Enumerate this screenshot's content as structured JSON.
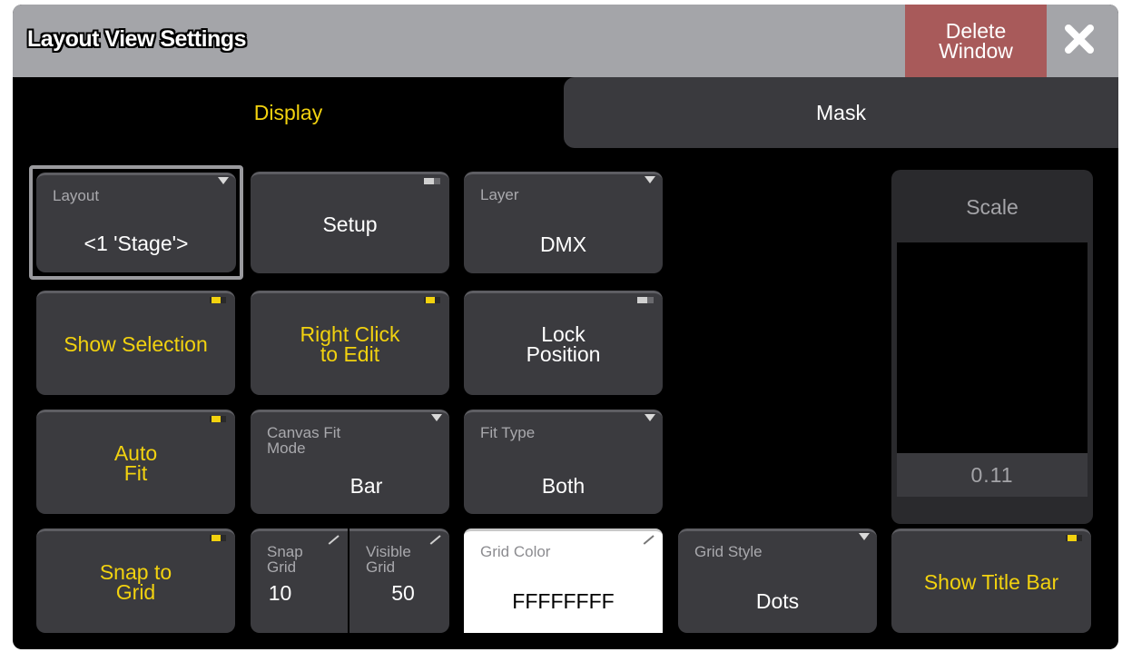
{
  "window": {
    "title": "Layout View Settings",
    "delete_label": "Delete\nWindow",
    "close_icon": "close-icon"
  },
  "tabs": [
    {
      "label": "Display",
      "active": true
    },
    {
      "label": "Mask",
      "active": false
    }
  ],
  "buttons": {
    "layout": {
      "label": "Layout",
      "value": "<1 'Stage'>"
    },
    "setup": {
      "label": "Setup"
    },
    "layer": {
      "label": "Layer",
      "value": "DMX"
    },
    "show_selection": {
      "label": "Show Selection",
      "state": "on"
    },
    "right_click": {
      "label": "Right Click\nto Edit",
      "state": "on"
    },
    "lock_position": {
      "label": "Lock\nPosition",
      "state": "off"
    },
    "auto_fit": {
      "label": "Auto\nFit",
      "state": "on"
    },
    "canvas_fit_mode": {
      "label": "Canvas Fit\nMode",
      "value": "Bar"
    },
    "fit_type": {
      "label": "Fit Type",
      "value": "Both"
    },
    "snap_to_grid": {
      "label": "Snap to\nGrid",
      "state": "on"
    },
    "snap_grid": {
      "label": "Snap\nGrid",
      "value": "10"
    },
    "visible_grid": {
      "label": "Visible\nGrid",
      "value": "50"
    },
    "grid_color": {
      "label": "Grid Color",
      "value": "FFFFFFFF"
    },
    "grid_style": {
      "label": "Grid Style",
      "value": "Dots"
    },
    "show_title_bar": {
      "label": "Show Title Bar",
      "state": "on"
    }
  },
  "scale": {
    "label": "Scale",
    "value": "0.11"
  },
  "colors": {
    "accent": "#f2d20f",
    "delete": "#a85a5a",
    "button": "#3b3b3f"
  }
}
